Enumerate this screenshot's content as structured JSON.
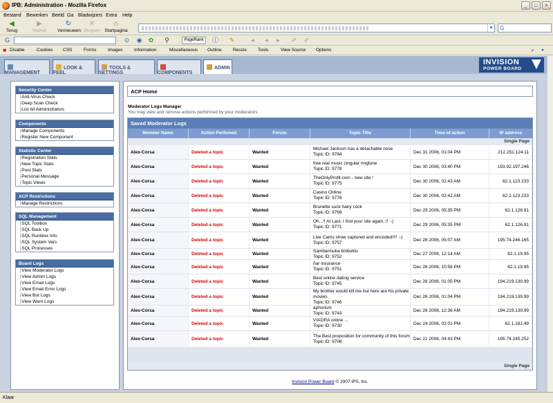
{
  "window": {
    "title": "IPB: Administration - Mozilla Firefox"
  },
  "menu": [
    "Bestand",
    "Bewerken",
    "Beeld",
    "Ga",
    "Bladwijzers",
    "Extra",
    "Help"
  ],
  "nav": {
    "back": "Terug",
    "forward": "Vooruit",
    "reload": "Vernieuwen",
    "stop": "Stoppen",
    "home": "Startpagina"
  },
  "toolbar2": {
    "pagerank": "PageRank"
  },
  "webdev": [
    "Disable",
    "Cookies",
    "CSS",
    "Forms",
    "Images",
    "Information",
    "Miscellaneous",
    "Outline",
    "Resize",
    "Tools",
    "View Source",
    "Options"
  ],
  "tabs": [
    {
      "label": "MANAGEMENT"
    },
    {
      "label": "LOOK & FEEL"
    },
    {
      "label": "TOOLS & SETTINGS"
    },
    {
      "label": "COMPONENTS"
    },
    {
      "label": "ADMIN"
    }
  ],
  "logo": {
    "line1": "INVISION",
    "line2": "POWER BOARD"
  },
  "sidebar": [
    {
      "title": "Security Center",
      "items": [
        "Anti-Virus Check",
        "Deep Scan Check",
        "List All Administrators"
      ]
    },
    {
      "title": "Components",
      "items": [
        "Manage Components",
        "Register New Component"
      ]
    },
    {
      "title": "Statistic Center",
      "items": [
        "Registration Stats",
        "New Topic Stats",
        "Post Stats",
        "Personal Message",
        "Topic Views"
      ]
    },
    {
      "title": "ACP Restrictions",
      "items": [
        "Manage Restrictions"
      ]
    },
    {
      "title": "SQL Management",
      "items": [
        "SQL Toolbox",
        "SQL Back Up",
        "SQL Runtime Info",
        "SQL System Vars",
        "SQL Processes"
      ]
    },
    {
      "title": "Board Logs",
      "items": [
        "View Moderator Logs",
        "View Admin Logs",
        "View Email Logs",
        "View Email Error Logs",
        "View Bot Logs",
        "View Warn Logs"
      ]
    }
  ],
  "main": {
    "heading": "ACP Home",
    "section_title": "Moderator Logs Manager",
    "section_desc": "You may view and remove actions performed by your moderators",
    "table_title": "Saved Moderator Logs",
    "columns": [
      "Member Name",
      "Action Perfomed",
      "Forum",
      "Topic Title",
      "Time of action",
      "IP address"
    ],
    "pagination": "Single Page",
    "rows": [
      {
        "member": "Alex-Corsa",
        "action": "Deleted a topic",
        "forum": "Wanted",
        "topic": "Michael Jackson has a detachable nose",
        "topic_id": "Topic ID: 9784",
        "time": "Dec 31 2006, 01:04 PM",
        "ip": "212.251.124.11"
      },
      {
        "member": "Alex-Corsa",
        "action": "Deleted a topic",
        "forum": "Wanted",
        "topic": "free real music cingular ringtone",
        "topic_id": "Topic ID: 9778",
        "time": "Dec 30 2006, 03:40 PM",
        "ip": "193.92.197.246"
      },
      {
        "member": "Alex-Corsa",
        "action": "Deleted a topic",
        "forum": "Wanted",
        "topic": "TheOnlyProfit.com - new site !",
        "topic_id": "Topic ID: 9775",
        "time": "Dec 30 2006, 02:43 AM",
        "ip": "62.1.123.233"
      },
      {
        "member": "Alex-Corsa",
        "action": "Deleted a topic",
        "forum": "Wanted",
        "topic": "Casino Online",
        "topic_id": "Topic ID: 9776",
        "time": "Dec 30 2006, 02:42 AM",
        "ip": "62.1.123.233"
      },
      {
        "member": "Alex-Corsa",
        "action": "Deleted a topic",
        "forum": "Wanted",
        "topic": "Brunette suck hairy cock",
        "topic_id": "Topic ID: 9769",
        "time": "Dec 29 2006, 05:35 PM",
        "ip": "62.1.126.91"
      },
      {
        "member": "Alex-Corsa",
        "action": "Deleted a topic",
        "forum": "Wanted",
        "topic": "Oh...!! At Last, I find your site again..!! :-)",
        "topic_id": "Topic ID: 9771",
        "time": "Dec 29 2006, 05:35 PM",
        "ip": "62.1.126.91"
      },
      {
        "member": "Alex-Corsa",
        "action": "Deleted a topic",
        "forum": "Wanted",
        "topic": "Live Cams show captured and encoded!!!! :-)",
        "topic_id": "Topic ID: 9757",
        "time": "Dec 28 2006, 05:07 AM",
        "ip": "195.74.246.165"
      },
      {
        "member": "Alex-Corsa",
        "action": "Deleted a topic",
        "forum": "Wanted",
        "topic": "Sambarmuka timbuktu",
        "topic_id": "Topic ID: 9752",
        "time": "Dec 27 2006, 12:14 AM",
        "ip": "62.1.19.95"
      },
      {
        "member": "Alex-Corsa",
        "action": "Deleted a topic",
        "forum": "Wanted",
        "topic": "ñar insurance",
        "topic_id": "Topic ID: 9751",
        "time": "Dec 26 2006, 10:56 PM",
        "ip": "62.1.19.95"
      },
      {
        "member": "Alex-Corsa",
        "action": "Deleted a topic",
        "forum": "Wanted",
        "topic": "Best online dating service",
        "topic_id": "Topic ID: 9745",
        "time": "Dec 26 2006, 01:05 PM",
        "ip": "194.219.139.99"
      },
      {
        "member": "Alex-Corsa",
        "action": "Deleted a topic",
        "forum": "Wanted",
        "topic": "My brother would kill me but here are his private movies",
        "topic_id": "Topic ID: 9746",
        "time": "Dec 26 2006, 01:04 PM",
        "ip": "194.219.139.99"
      },
      {
        "member": "Alex-Corsa",
        "action": "Deleted a topic",
        "forum": "Wanted",
        "topic": "aphorism",
        "topic_id": "Topic ID: 9743",
        "time": "Dec 26 2006, 12:36 AM",
        "ip": "194.219.139.99"
      },
      {
        "member": "Alex-Corsa",
        "action": "Deleted a topic",
        "forum": "Wanted",
        "topic": "VIAGRA online ...",
        "topic_id": "Topic ID: 9730",
        "time": "Dec 24 2006, 02:01 PM",
        "ip": "62.1.181.49"
      },
      {
        "member": "Alex-Corsa",
        "action": "Deleted a topic",
        "forum": "Wanted",
        "topic": "The Best proposition for community of this forum",
        "topic_id": "Topic ID: 9708",
        "time": "Dec 21 2006, 04:43 PM",
        "ip": "195.74.245.252"
      }
    ]
  },
  "footer": {
    "link": "Invision Power Board",
    "text": " © 2007 IPS, Inc."
  },
  "status": "Klaar"
}
